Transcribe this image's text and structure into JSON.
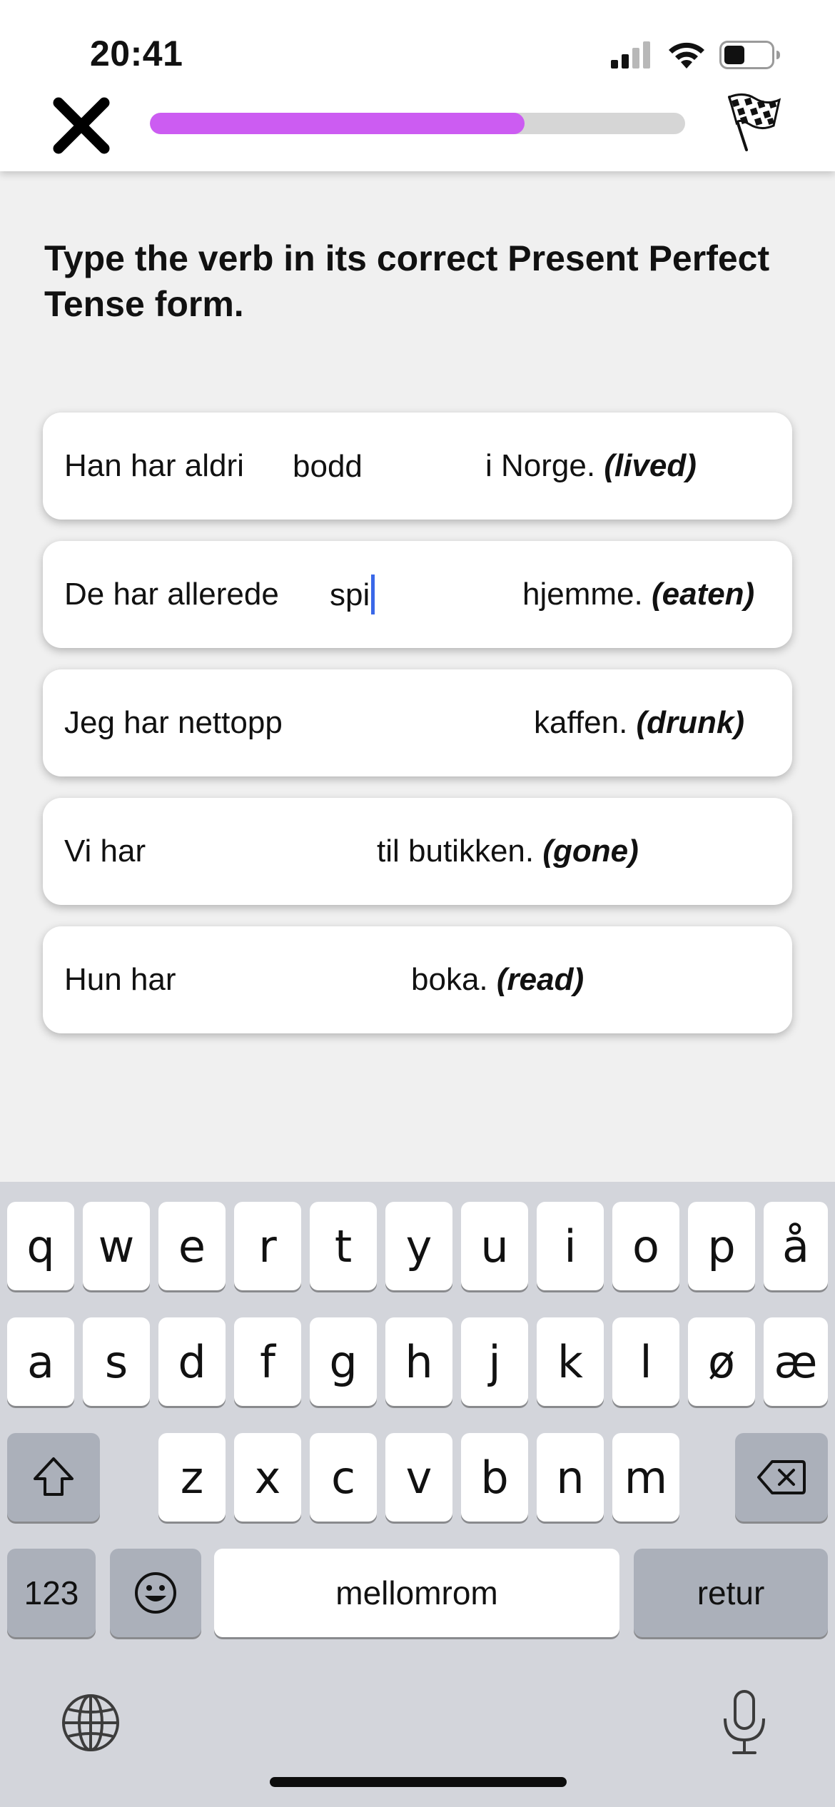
{
  "status_bar": {
    "time": "20:41"
  },
  "progress": {
    "value": 0.7
  },
  "instruction": "Type the verb in its correct Present Perfect Tense form.",
  "exercises": [
    {
      "prefix": "Han har aldri",
      "answer": "bodd",
      "suffix": "i Norge.",
      "hint": "(lived)"
    },
    {
      "prefix": "De har allerede",
      "answer": "spi",
      "suffix": "hjemme.",
      "hint": "(eaten)"
    },
    {
      "prefix": "Jeg har nettopp",
      "answer": "",
      "suffix": "kaffen.",
      "hint": "(drunk)"
    },
    {
      "prefix": "Vi har",
      "answer": "",
      "suffix": "til butikken.",
      "hint": "(gone)"
    },
    {
      "prefix": "Hun har",
      "answer": "",
      "suffix": "boka.",
      "hint": "(read)"
    }
  ],
  "keyboard": {
    "row1": [
      "q",
      "w",
      "e",
      "r",
      "t",
      "y",
      "u",
      "i",
      "o",
      "p",
      "å"
    ],
    "row2": [
      "a",
      "s",
      "d",
      "f",
      "g",
      "h",
      "j",
      "k",
      "l",
      "ø",
      "æ"
    ],
    "row3": [
      "z",
      "x",
      "c",
      "v",
      "b",
      "n",
      "m"
    ],
    "numbers_label": "123",
    "space_label": "mellomrom",
    "return_label": "retur"
  },
  "icons": {
    "close": "close-icon",
    "flag": "checkered-flag-icon",
    "shift": "shift-icon",
    "backspace": "backspace-icon",
    "emoji": "emoji-icon",
    "globe": "globe-icon",
    "microphone": "microphone-icon"
  },
  "colors": {
    "progress_fill": "#cc5cf2",
    "progress_track": "#d6d6d6",
    "caret": "#3a68e8",
    "keyboard_bg": "#d3d5db"
  }
}
